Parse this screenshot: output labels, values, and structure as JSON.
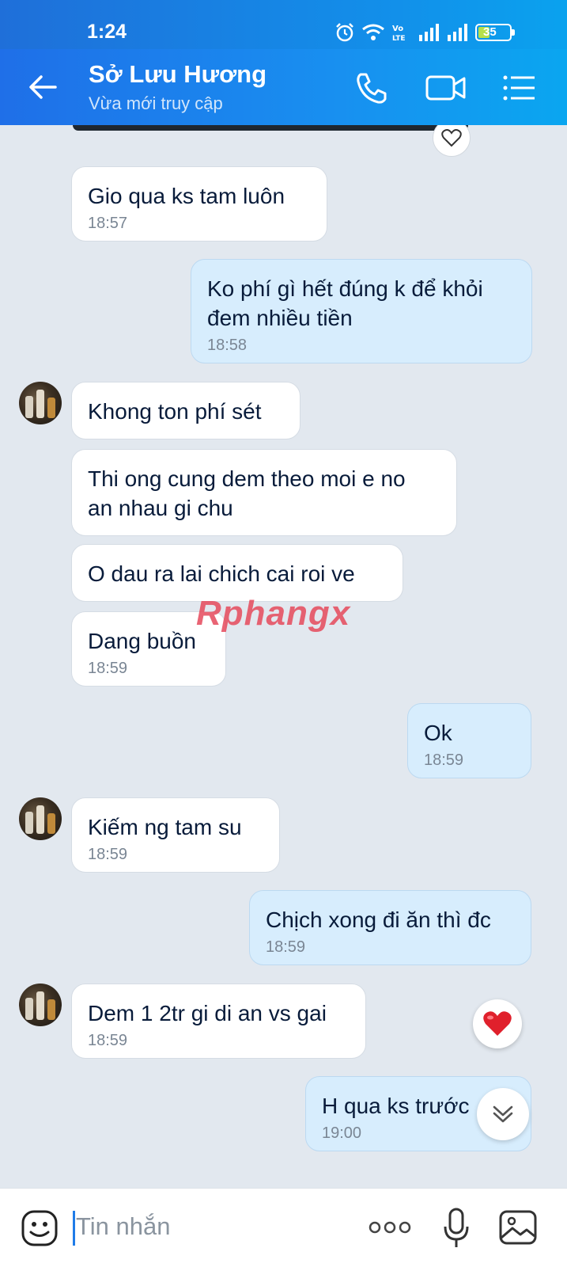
{
  "status_bar": {
    "time": "1:24",
    "battery": "35"
  },
  "header": {
    "contact_name": "Sở Lưu Hương",
    "status": "Vừa mới truy cập"
  },
  "watermark": "Rphangx",
  "messages": [
    {
      "dir": "in",
      "text": "Gio qua ks tam luôn",
      "time": "18:57"
    },
    {
      "dir": "out",
      "text": "Ko phí gì hết đúng k để khỏi\nđem nhiều tiền",
      "time": "18:58"
    },
    {
      "dir": "in",
      "text": "Khong ton phí sét",
      "time": ""
    },
    {
      "dir": "in",
      "text": "Thi ong cung dem theo moi e no\nan nhau gi chu",
      "time": ""
    },
    {
      "dir": "in",
      "text": "O dau ra lai chich cai roi ve",
      "time": ""
    },
    {
      "dir": "in",
      "text": "Dang buồn",
      "time": "18:59"
    },
    {
      "dir": "out",
      "text": "Ok",
      "time": "18:59"
    },
    {
      "dir": "in",
      "text": "Kiếm ng tam su",
      "time": "18:59"
    },
    {
      "dir": "out",
      "text": "Chịch xong đi ăn thì đc",
      "time": "18:59"
    },
    {
      "dir": "in",
      "text": "Dem 1 2tr gi di an vs gai",
      "time": "18:59"
    },
    {
      "dir": "out",
      "text": "H qua ks trước",
      "time": "19:00"
    }
  ],
  "input": {
    "placeholder": "Tin nhắn"
  },
  "icons": [
    "back-arrow-icon",
    "phone-icon",
    "video-icon",
    "menu-icon",
    "heart-icon",
    "smile-icon",
    "more-icon",
    "mic-icon",
    "gallery-icon",
    "chevron-down-icon"
  ],
  "colors": {
    "header": "#1a86ee",
    "out_bubble": "#d7edfd",
    "in_bubble": "#ffffff",
    "background": "#e2e8ef",
    "reaction": "#e0202c"
  }
}
